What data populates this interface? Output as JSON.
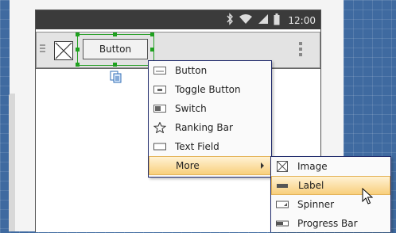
{
  "statusbar": {
    "time": "12:00",
    "icons": [
      "bluetooth-icon",
      "wifi-icon",
      "signal-icon",
      "battery-icon"
    ]
  },
  "toolbar": {
    "button_label": "Button",
    "icons": [
      "hamburger-icon",
      "image-placeholder-icon",
      "overflow-menu-icon"
    ]
  },
  "context_menu": {
    "items": [
      {
        "label": "Button",
        "icon": "button-icon"
      },
      {
        "label": "Toggle Button",
        "icon": "toggle-button-icon"
      },
      {
        "label": "Switch",
        "icon": "switch-icon"
      },
      {
        "label": "Ranking Bar",
        "icon": "star-icon"
      },
      {
        "label": "Text Field",
        "icon": "text-field-icon"
      },
      {
        "label": "More",
        "icon": "submenu-arrow-icon",
        "highlighted": true
      }
    ]
  },
  "submenu": {
    "items": [
      {
        "label": "Image",
        "icon": "image-icon"
      },
      {
        "label": "Label",
        "icon": "label-icon",
        "highlighted": true
      },
      {
        "label": "Spinner",
        "icon": "spinner-icon"
      },
      {
        "label": "Progress Bar",
        "icon": "progress-bar-icon"
      }
    ]
  },
  "colors": {
    "canvas_background": "#3f6aa0",
    "statusbar": "#3b3b3b",
    "selection_handles": "#1fa11f",
    "menu_highlight": "#f8cf7c",
    "menu_border": "#1f2a6b"
  }
}
